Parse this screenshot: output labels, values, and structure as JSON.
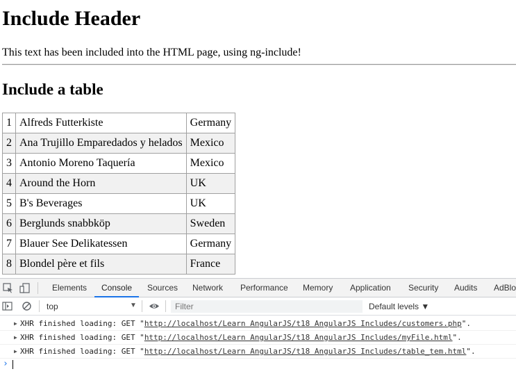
{
  "page": {
    "heading": "Include Header",
    "paragraph": "This text has been included into the HTML page, using ng-include!",
    "table_heading": "Include a table",
    "table_rows": [
      [
        "1",
        "Alfreds Futterkiste",
        "Germany"
      ],
      [
        "2",
        "Ana Trujillo Emparedados y helados",
        "Mexico"
      ],
      [
        "3",
        "Antonio Moreno Taquería",
        "Mexico"
      ],
      [
        "4",
        "Around the Horn",
        "UK"
      ],
      [
        "5",
        "B's Beverages",
        "UK"
      ],
      [
        "6",
        "Berglunds snabbköp",
        "Sweden"
      ],
      [
        "7",
        "Blauer See Delikatessen",
        "Germany"
      ],
      [
        "8",
        "Blondel père et fils",
        "France"
      ]
    ]
  },
  "devtools": {
    "tabs": [
      "Elements",
      "Console",
      "Sources",
      "Network",
      "Performance",
      "Memory",
      "Application",
      "Security",
      "Audits",
      "AdBlock"
    ],
    "active_tab": "Console",
    "context": "top",
    "filter_placeholder": "Filter",
    "levels": "Default levels ▼",
    "logs": [
      {
        "prefix": "XHR finished loading: GET \"",
        "url": "http://localhost/Learn AngularJS/t18 AngularJS Includes/customers.php",
        "suffix": "\"."
      },
      {
        "prefix": "XHR finished loading: GET \"",
        "url": "http://localhost/Learn AngularJS/t18 AngularJS Includes/myFile.html",
        "suffix": "\"."
      },
      {
        "prefix": "XHR finished loading: GET \"",
        "url": "http://localhost/Learn AngularJS/t18 AngularJS Includes/table_tem.html",
        "suffix": "\"."
      }
    ],
    "prompt": "›",
    "colors": {
      "accent": "#1a73e8",
      "tabbar_bg": "#f3f3f3",
      "row_alt": "#f1f1f1"
    },
    "icons": [
      "inspect-icon",
      "device-toolbar-icon",
      "sidebar-toggle-icon",
      "clear-console-icon",
      "eye-icon"
    ]
  }
}
